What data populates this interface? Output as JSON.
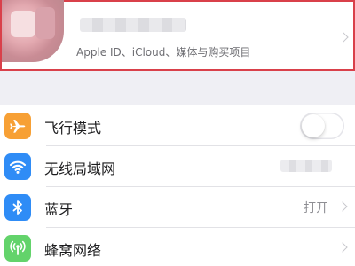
{
  "profile": {
    "subtitle": "Apple ID、iCloud、媒体与购买项目"
  },
  "settings": {
    "items": [
      {
        "label": "飞行模式",
        "icon": "airplane-icon",
        "icon_color": "#f7a035",
        "control": "toggle",
        "toggle_on": false
      },
      {
        "label": "无线局域网",
        "icon": "wifi-icon",
        "icon_color": "#2f8cf6",
        "control": "value"
      },
      {
        "label": "蓝牙",
        "icon": "bluetooth-icon",
        "icon_color": "#2f8cf6",
        "control": "value",
        "value": "打开"
      },
      {
        "label": "蜂窝网络",
        "icon": "cellular-icon",
        "icon_color": "#63d36b",
        "control": "chevron"
      }
    ]
  },
  "colors": {
    "highlight_border": "#d9404a",
    "background": "#efeff4"
  }
}
